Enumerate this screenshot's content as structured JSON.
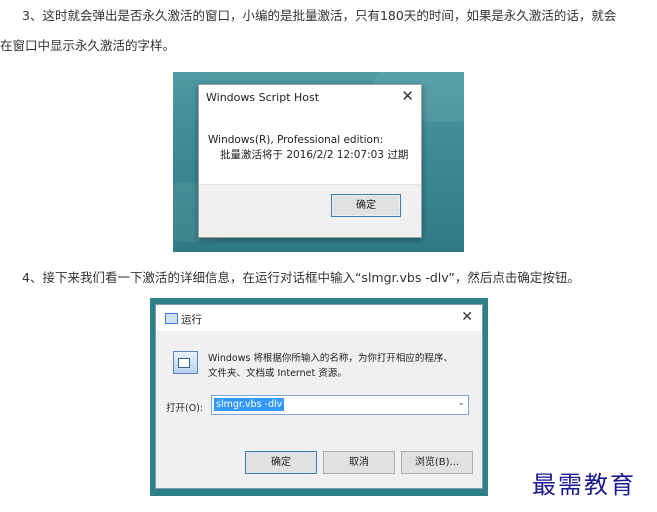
{
  "article": {
    "step3_line1": "3、这时就会弹出是否永久激活的窗口，小编的是批量激活，只有180天的时间，如果是永久激活的话，就会",
    "step3_line2": "在窗口中显示永久激活的字样。",
    "step4": "4、接下来我们看一下激活的详细信息，在运行对话框中输入“slmgr.vbs -dlv”，然后点击确定按钮。"
  },
  "script_host_dialog": {
    "title": "Windows Script Host",
    "message_line1": "Windows(R), Professional edition:",
    "message_line2": "批量激活将于 2016/2/2 12:07:03 过期",
    "ok_label": "确定",
    "close_glyph": "✕"
  },
  "run_dialog": {
    "title": "运行",
    "close_glyph": "✕",
    "description_line1": "Windows 将根据你所输入的名称，为你打开相应的程序、",
    "description_line2": "文件夹、文档或 Internet 资源。",
    "open_label": "打开(O):",
    "input_value": "slmgr.vbs -dlv",
    "dropdown_glyph": "⌄",
    "ok_label": "确定",
    "cancel_label": "取消",
    "browse_label": "浏览(B)..."
  },
  "watermark": "最需教育",
  "icons": {
    "run_title_icon": "run-window-icon",
    "run_big_icon": "run-program-icon"
  },
  "colors": {
    "desktop_teal": "#3e8b95",
    "selection_blue": "#3399ff",
    "watermark_blue": "#1b1a8f"
  }
}
